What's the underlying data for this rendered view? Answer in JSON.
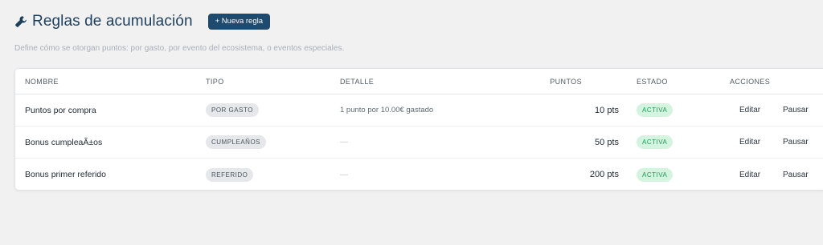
{
  "header": {
    "title": "Reglas de acumulación",
    "new_button": "+ Nueva regla",
    "subtitle": "Define cómo se otorgan puntos: por gasto, por evento del ecosistema, o eventos especiales."
  },
  "table": {
    "columns": {
      "name": "NOMBRE",
      "type": "TIPO",
      "detail": "DETALLE",
      "points": "PUNTOS",
      "status": "ESTADO",
      "actions": "ACCIONES"
    },
    "rows": [
      {
        "name": "Puntos por compra",
        "type": "POR GASTO",
        "detail": "1 punto por 10.00€ gastado",
        "points": "10 pts",
        "status": "ACTIVA",
        "edit": "Editar",
        "pause": "Pausar"
      },
      {
        "name": "Bonus cumpleaÃ±os",
        "type": "CUMPLEAÑOS",
        "detail": "—",
        "points": "50 pts",
        "status": "ACTIVA",
        "edit": "Editar",
        "pause": "Pausar"
      },
      {
        "name": "Bonus primer referido",
        "type": "REFERIDO",
        "detail": "—",
        "points": "200 pts",
        "status": "ACTIVA",
        "edit": "Editar",
        "pause": "Pausar"
      }
    ]
  },
  "colors": {
    "title": "#1c3f5e",
    "button_bg": "#1e4a6d",
    "status_bg": "#d4f4e0",
    "status_fg": "#1a9a57",
    "type_bg": "#e5e7ea"
  },
  "icons": {
    "title_icon": "wrench-icon"
  }
}
